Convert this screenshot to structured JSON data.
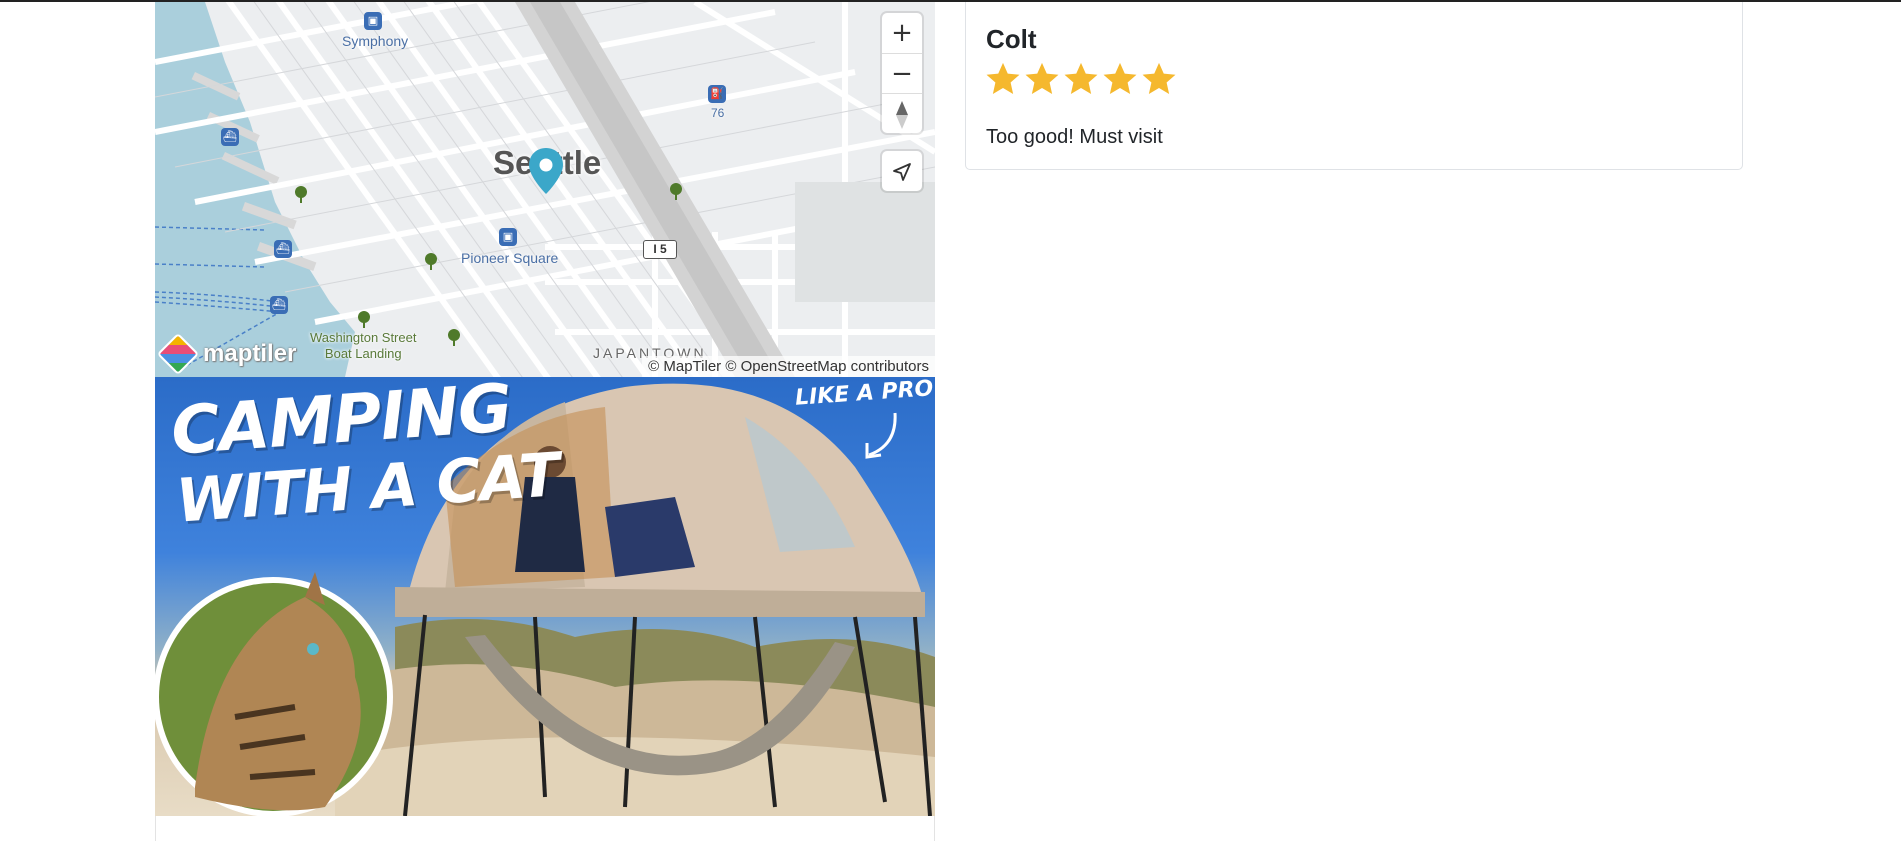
{
  "map": {
    "labels": {
      "symphony": "Symphony",
      "city": "Seattle",
      "pioneer_square": "Pioneer Square",
      "washington_street": "Washington Street",
      "boat_landing": "Boat Landing",
      "japantown": "JAPANTOWN",
      "highway": "I 5",
      "gas_number": "76"
    },
    "controls": {
      "zoom_in": "+",
      "zoom_out": "−",
      "compass": "compass-icon",
      "geolocate": "navigate-icon"
    },
    "attribution": {
      "maptiler": "© MapTiler",
      "osm": "© OpenStreetMap contributors"
    },
    "logo_text": "maptiler",
    "marker_color": "#3ba7c9"
  },
  "campground_image": {
    "title_line1": "CAMPING",
    "title_line2": "WITH A CAT",
    "tag": "LIKE A PRO"
  },
  "review": {
    "author": "Colt",
    "rating": 5,
    "rating_max": 5,
    "body": "Too good! Must visit",
    "star_color": "#f5b82e"
  }
}
